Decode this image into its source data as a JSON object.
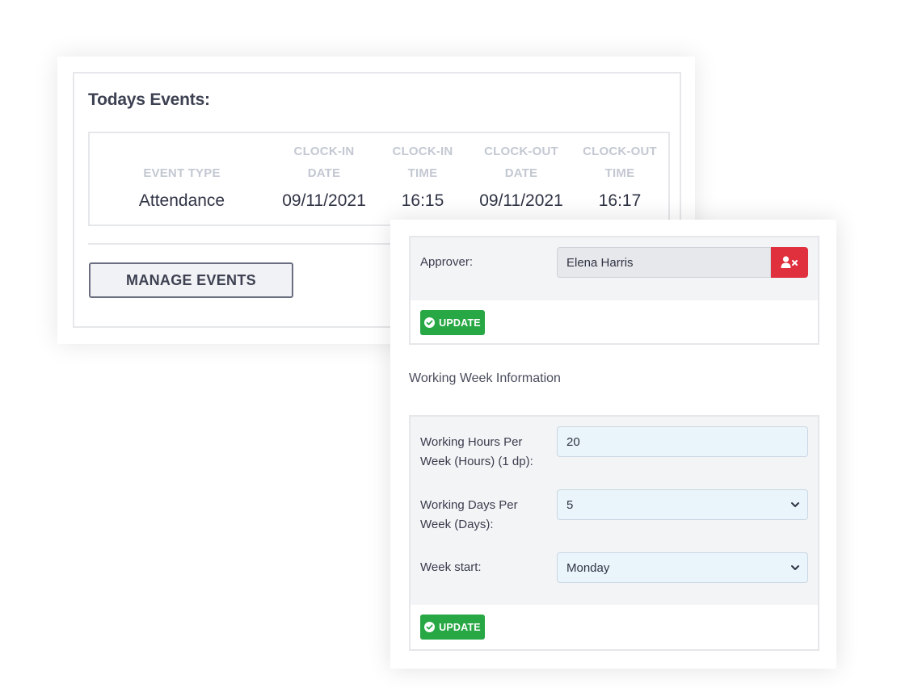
{
  "events": {
    "title": "Todays Events:",
    "columns": [
      {
        "header_line1": "",
        "header_line2": "EVENT TYPE",
        "value": "Attendance"
      },
      {
        "header_line1": "CLOCK-IN",
        "header_line2": "DATE",
        "value": "09/11/2021"
      },
      {
        "header_line1": "CLOCK-IN",
        "header_line2": "TIME",
        "value": "16:15"
      },
      {
        "header_line1": "CLOCK-OUT",
        "header_line2": "DATE",
        "value": "09/11/2021"
      },
      {
        "header_line1": "CLOCK-OUT",
        "header_line2": "TIME",
        "value": "16:17"
      }
    ],
    "manage_label": "MANAGE EVENTS"
  },
  "approver": {
    "label": "Approver:",
    "value": "Elena Harris",
    "remove_icon": "user-remove-icon",
    "update_label": "UPDATE"
  },
  "working_week": {
    "section_title": "Working Week Information",
    "hours_label_line1": "Working Hours Per",
    "hours_label_line2": "Week (Hours) (1 dp):",
    "hours_value": "20",
    "days_label_line1": "Working Days Per",
    "days_label_line2": "Week (Days):",
    "days_value": "5",
    "start_label": "Week start:",
    "start_value": "Monday",
    "update_label": "UPDATE"
  },
  "colors": {
    "update_green": "#28a745",
    "remove_red": "#e0303d",
    "input_blue": "#eaf5fb",
    "header_gray": "#c3c8d2"
  }
}
